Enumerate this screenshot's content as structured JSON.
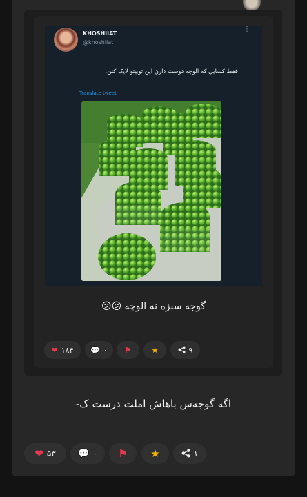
{
  "outer_post": {
    "caption": "اگه گوجه‌س باهاش املت درست ک-",
    "actions": {
      "likes": "۵۳",
      "comments": "۰",
      "shares": "۱"
    }
  },
  "quoted_post": {
    "caption": "گوجه سبزه نه الوچه 😕😕",
    "actions": {
      "likes": "۱۸۴",
      "comments": "۰",
      "shares": "۹"
    }
  },
  "tweet": {
    "display_name": "KHOSHIIAT",
    "handle": "@khoshiiat",
    "text": "فقط کسایی که آلوچه دوست دارن این توییتو لایک کنن.",
    "translate_label": "Translate tweet"
  },
  "colors": {
    "page_bg": "#131313",
    "card_bg": "#272727",
    "accent_red": "#e53950",
    "accent_star": "#f5b400",
    "tweet_bg": "#15202b",
    "link_blue": "#1d9bf0"
  },
  "icons": {
    "like": "heart-icon",
    "comment": "comment-icon",
    "report": "flag-icon",
    "favorite": "star-icon",
    "share": "share-icon"
  }
}
